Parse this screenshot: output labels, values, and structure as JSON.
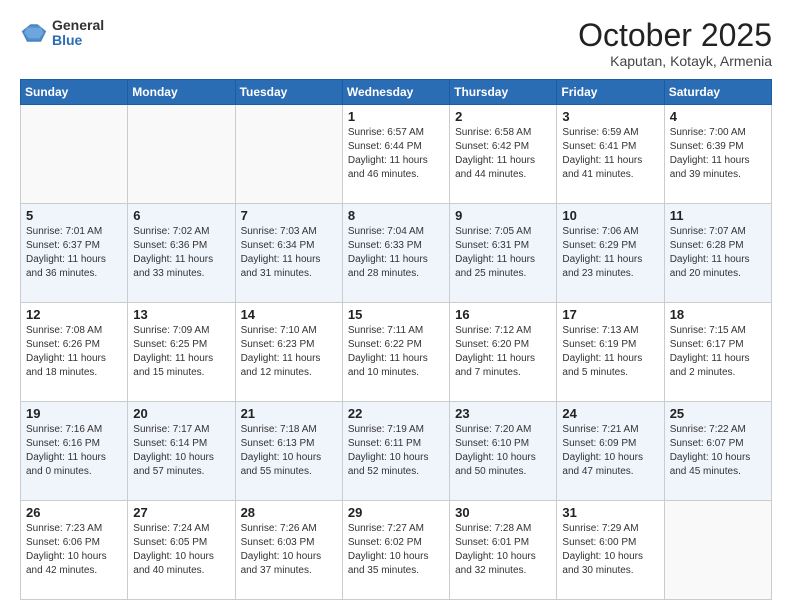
{
  "header": {
    "logo_general": "General",
    "logo_blue": "Blue",
    "month_title": "October 2025",
    "subtitle": "Kaputan, Kotayk, Armenia"
  },
  "weekdays": [
    "Sunday",
    "Monday",
    "Tuesday",
    "Wednesday",
    "Thursday",
    "Friday",
    "Saturday"
  ],
  "weeks": [
    [
      {
        "day": "",
        "info": ""
      },
      {
        "day": "",
        "info": ""
      },
      {
        "day": "",
        "info": ""
      },
      {
        "day": "1",
        "info": "Sunrise: 6:57 AM\nSunset: 6:44 PM\nDaylight: 11 hours and 46 minutes."
      },
      {
        "day": "2",
        "info": "Sunrise: 6:58 AM\nSunset: 6:42 PM\nDaylight: 11 hours and 44 minutes."
      },
      {
        "day": "3",
        "info": "Sunrise: 6:59 AM\nSunset: 6:41 PM\nDaylight: 11 hours and 41 minutes."
      },
      {
        "day": "4",
        "info": "Sunrise: 7:00 AM\nSunset: 6:39 PM\nDaylight: 11 hours and 39 minutes."
      }
    ],
    [
      {
        "day": "5",
        "info": "Sunrise: 7:01 AM\nSunset: 6:37 PM\nDaylight: 11 hours and 36 minutes."
      },
      {
        "day": "6",
        "info": "Sunrise: 7:02 AM\nSunset: 6:36 PM\nDaylight: 11 hours and 33 minutes."
      },
      {
        "day": "7",
        "info": "Sunrise: 7:03 AM\nSunset: 6:34 PM\nDaylight: 11 hours and 31 minutes."
      },
      {
        "day": "8",
        "info": "Sunrise: 7:04 AM\nSunset: 6:33 PM\nDaylight: 11 hours and 28 minutes."
      },
      {
        "day": "9",
        "info": "Sunrise: 7:05 AM\nSunset: 6:31 PM\nDaylight: 11 hours and 25 minutes."
      },
      {
        "day": "10",
        "info": "Sunrise: 7:06 AM\nSunset: 6:29 PM\nDaylight: 11 hours and 23 minutes."
      },
      {
        "day": "11",
        "info": "Sunrise: 7:07 AM\nSunset: 6:28 PM\nDaylight: 11 hours and 20 minutes."
      }
    ],
    [
      {
        "day": "12",
        "info": "Sunrise: 7:08 AM\nSunset: 6:26 PM\nDaylight: 11 hours and 18 minutes."
      },
      {
        "day": "13",
        "info": "Sunrise: 7:09 AM\nSunset: 6:25 PM\nDaylight: 11 hours and 15 minutes."
      },
      {
        "day": "14",
        "info": "Sunrise: 7:10 AM\nSunset: 6:23 PM\nDaylight: 11 hours and 12 minutes."
      },
      {
        "day": "15",
        "info": "Sunrise: 7:11 AM\nSunset: 6:22 PM\nDaylight: 11 hours and 10 minutes."
      },
      {
        "day": "16",
        "info": "Sunrise: 7:12 AM\nSunset: 6:20 PM\nDaylight: 11 hours and 7 minutes."
      },
      {
        "day": "17",
        "info": "Sunrise: 7:13 AM\nSunset: 6:19 PM\nDaylight: 11 hours and 5 minutes."
      },
      {
        "day": "18",
        "info": "Sunrise: 7:15 AM\nSunset: 6:17 PM\nDaylight: 11 hours and 2 minutes."
      }
    ],
    [
      {
        "day": "19",
        "info": "Sunrise: 7:16 AM\nSunset: 6:16 PM\nDaylight: 11 hours and 0 minutes."
      },
      {
        "day": "20",
        "info": "Sunrise: 7:17 AM\nSunset: 6:14 PM\nDaylight: 10 hours and 57 minutes."
      },
      {
        "day": "21",
        "info": "Sunrise: 7:18 AM\nSunset: 6:13 PM\nDaylight: 10 hours and 55 minutes."
      },
      {
        "day": "22",
        "info": "Sunrise: 7:19 AM\nSunset: 6:11 PM\nDaylight: 10 hours and 52 minutes."
      },
      {
        "day": "23",
        "info": "Sunrise: 7:20 AM\nSunset: 6:10 PM\nDaylight: 10 hours and 50 minutes."
      },
      {
        "day": "24",
        "info": "Sunrise: 7:21 AM\nSunset: 6:09 PM\nDaylight: 10 hours and 47 minutes."
      },
      {
        "day": "25",
        "info": "Sunrise: 7:22 AM\nSunset: 6:07 PM\nDaylight: 10 hours and 45 minutes."
      }
    ],
    [
      {
        "day": "26",
        "info": "Sunrise: 7:23 AM\nSunset: 6:06 PM\nDaylight: 10 hours and 42 minutes."
      },
      {
        "day": "27",
        "info": "Sunrise: 7:24 AM\nSunset: 6:05 PM\nDaylight: 10 hours and 40 minutes."
      },
      {
        "day": "28",
        "info": "Sunrise: 7:26 AM\nSunset: 6:03 PM\nDaylight: 10 hours and 37 minutes."
      },
      {
        "day": "29",
        "info": "Sunrise: 7:27 AM\nSunset: 6:02 PM\nDaylight: 10 hours and 35 minutes."
      },
      {
        "day": "30",
        "info": "Sunrise: 7:28 AM\nSunset: 6:01 PM\nDaylight: 10 hours and 32 minutes."
      },
      {
        "day": "31",
        "info": "Sunrise: 7:29 AM\nSunset: 6:00 PM\nDaylight: 10 hours and 30 minutes."
      },
      {
        "day": "",
        "info": ""
      }
    ]
  ]
}
